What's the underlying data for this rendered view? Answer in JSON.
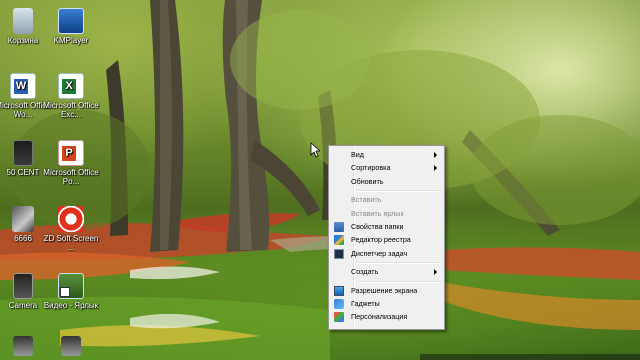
{
  "desktop": {
    "icons": [
      {
        "label": "Корзина",
        "icon": "recycle-bin-icon"
      },
      {
        "label": "KMPlayer",
        "icon": "kmplayer-icon"
      },
      {
        "label": "Microsoft Office Wo...",
        "icon": "word-icon"
      },
      {
        "label": "Microsoft Office Exc...",
        "icon": "excel-icon"
      },
      {
        "label": "50 CENT",
        "icon": "music-file-icon"
      },
      {
        "label": "Microsoft Office Po...",
        "icon": "powerpoint-icon"
      },
      {
        "label": "6666",
        "icon": "image-file-icon"
      },
      {
        "label": "ZD Soft Screen ...",
        "icon": "zd-soft-screen-recorder-icon"
      },
      {
        "label": "Camera",
        "icon": "camera-icon"
      },
      {
        "label": "Видео - Ярлык",
        "icon": "video-shortcut-icon"
      }
    ]
  },
  "context_menu": {
    "items": [
      {
        "label": "Вид",
        "submenu": true,
        "disabled": false
      },
      {
        "label": "Сортировка",
        "submenu": true,
        "disabled": false
      },
      {
        "label": "Обновить",
        "submenu": false,
        "disabled": false
      },
      {
        "label": "Вставить",
        "submenu": false,
        "disabled": true
      },
      {
        "label": "Вставить ярлык",
        "submenu": false,
        "disabled": true
      },
      {
        "label": "Свойства папки",
        "submenu": false,
        "disabled": false,
        "icon": "folder-options-icon"
      },
      {
        "label": "Редактор реестра",
        "submenu": false,
        "disabled": false,
        "icon": "registry-editor-icon"
      },
      {
        "label": "Диспетчер задач",
        "submenu": false,
        "disabled": false,
        "icon": "task-manager-icon"
      },
      {
        "label": "Создать",
        "submenu": true,
        "disabled": false
      },
      {
        "label": "Разрешение экрана",
        "submenu": false,
        "disabled": false,
        "icon": "screen-resolution-icon"
      },
      {
        "label": "Гаджеты",
        "submenu": false,
        "disabled": false,
        "icon": "gadgets-icon"
      },
      {
        "label": "Персонализация",
        "submenu": false,
        "disabled": false,
        "icon": "personalization-icon"
      }
    ]
  },
  "colors": {
    "menu_background": "#f0f0f0",
    "menu_border": "#979797",
    "disabled_text": "#8a8a8a"
  }
}
